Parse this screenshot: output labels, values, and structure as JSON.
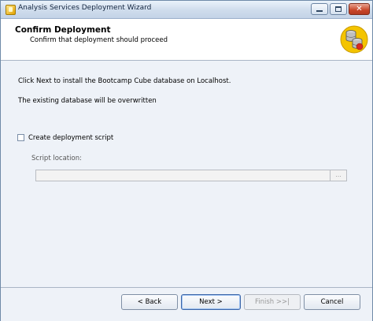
{
  "window": {
    "title": "Analysis Services Deployment Wizard",
    "controls": {
      "close_glyph": "✕"
    }
  },
  "header": {
    "title": "Confirm Deployment",
    "subtitle": "Confirm that deployment should proceed",
    "icon": "database-deploy-icon"
  },
  "content": {
    "info_line1": "Click Next to install the Bootcamp Cube database on Localhost.",
    "info_line2": "The existing database will be overwritten",
    "create_script": {
      "label": "Create deployment script",
      "checked": false
    },
    "script_location": {
      "label": "Script location:",
      "value": "",
      "enabled": false,
      "browse_label": "..."
    }
  },
  "buttons": {
    "back": "< Back",
    "next": "Next >",
    "finish": "Finish >>|",
    "cancel": "Cancel"
  },
  "colors": {
    "accent": "#3c66a8",
    "close_button": "#c8462a",
    "icon_yellow": "#f4c400"
  }
}
